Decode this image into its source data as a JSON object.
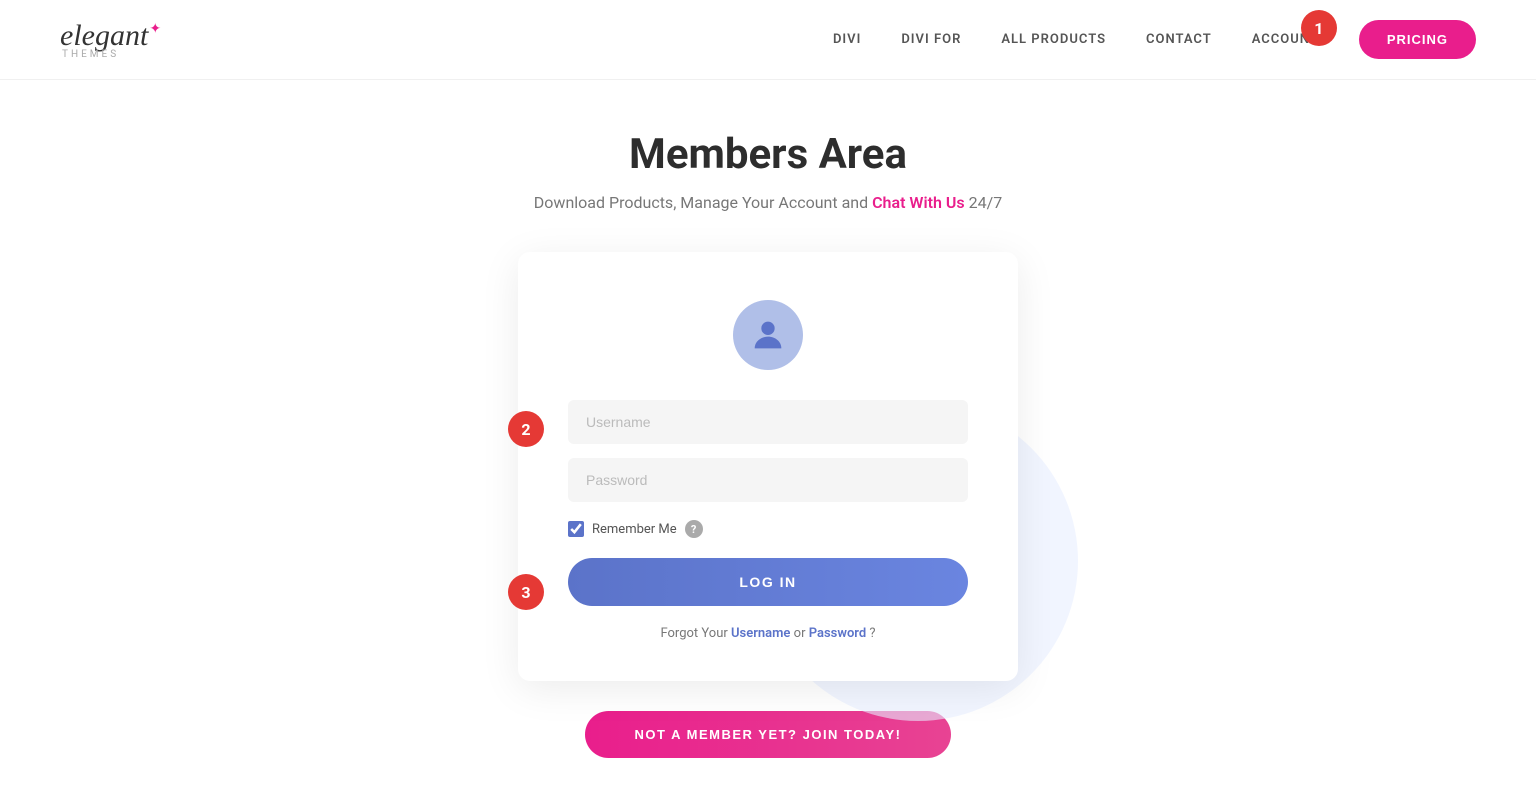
{
  "header": {
    "logo_text": "elegant",
    "logo_sub": "themes",
    "nav": {
      "items": [
        {
          "id": "divi",
          "label": "DIVI"
        },
        {
          "id": "divi-for",
          "label": "DIVI FOR"
        },
        {
          "id": "all-products",
          "label": "ALL PRODUCTS"
        },
        {
          "id": "contact",
          "label": "CONTACT"
        },
        {
          "id": "account",
          "label": "ACCOUNT"
        }
      ],
      "badge": "1",
      "pricing_label": "PRICING"
    }
  },
  "main": {
    "title": "Members Area",
    "subtitle_before": "Download Products, Manage Your Account and ",
    "subtitle_link": "Chat With Us",
    "subtitle_after": " 24/7"
  },
  "login_form": {
    "username_placeholder": "Username",
    "password_placeholder": "Password",
    "remember_label": "Remember Me",
    "login_label": "LOG IN",
    "forgot_before": "Forgot Your ",
    "forgot_username": "Username",
    "forgot_or": " or ",
    "forgot_password": "Password",
    "forgot_after": "?"
  },
  "join_banner": {
    "label": "NOT A MEMBER YET? JOIN TODAY!"
  },
  "annotations": {
    "1": "1",
    "2": "2",
    "3": "3"
  },
  "colors": {
    "pink": "#e91e8c",
    "blue": "#5b73c9",
    "red_badge": "#e53935"
  }
}
